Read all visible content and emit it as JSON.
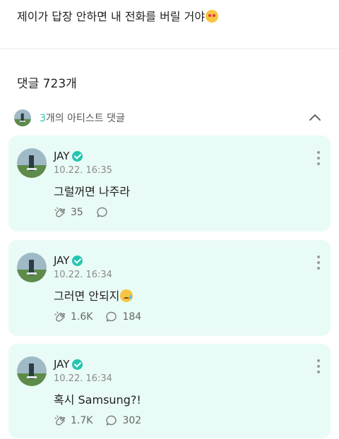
{
  "post": {
    "text": "제이가 답장 안하면 내 전화를 버릴 거야"
  },
  "comments_header": {
    "count_label": "댓글 723개"
  },
  "artist_bar": {
    "count": "3",
    "label_rest": "개의 아티스트 댓글"
  },
  "comments": [
    {
      "author": "JAY",
      "date": "10.22. 16:35",
      "text": "그럴꺼면 나주라",
      "likes": "35",
      "replies": ""
    },
    {
      "author": "JAY",
      "date": "10.22. 16:34",
      "text": "그러면 안되지",
      "likes": "1.6K",
      "replies": "184"
    },
    {
      "author": "JAY",
      "date": "10.22. 16:34",
      "text": "혹시 Samsung?!",
      "likes": "1.7K",
      "replies": "302"
    }
  ],
  "colors": {
    "card_bg": "#e9fbf6",
    "accent": "#2ec4b6",
    "verified": "#23c6b0"
  },
  "icons": {
    "like": "clap-like-icon",
    "reply": "speech-bubble-icon",
    "more": "more-vertical-icon",
    "collapse": "chevron-up-icon"
  }
}
